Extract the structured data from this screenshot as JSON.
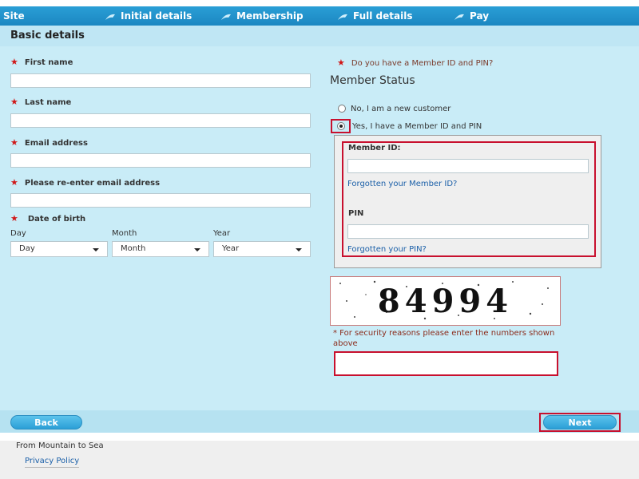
{
  "topnav": {
    "site": "Site",
    "steps": [
      "Initial details",
      "Membership",
      "Full details",
      "Pay"
    ]
  },
  "page": {
    "title": "Basic details"
  },
  "form": {
    "first_name_label": "First name",
    "last_name_label": "Last name",
    "email_label": "Email address",
    "reenter_email_label": "Please re-enter email address",
    "dob_label": "Date of birth",
    "day_label": "Day",
    "month_label": "Month",
    "year_label": "Year",
    "day_value": "Day",
    "month_value": "Month",
    "year_value": "Year"
  },
  "membership": {
    "question": "Do you have a Member ID and PIN?",
    "heading": "Member Status",
    "option_new": "No, I am a new customer",
    "option_existing": "Yes, I have a Member ID and PIN",
    "selected": "existing",
    "member_id_label": "Member ID:",
    "forgot_member_id": "Forgotten your Member ID?",
    "pin_label": "PIN",
    "forgot_pin": "Forgotten your PIN?"
  },
  "captcha": {
    "digits": "84994",
    "note": "* For security reasons please enter the numbers shown above"
  },
  "buttons": {
    "back": "Back",
    "next": "Next"
  },
  "footer": {
    "tagline": "From Mountain to Sea",
    "privacy": "Privacy Policy"
  },
  "colors": {
    "nav": "#1b87c1",
    "form_bg": "#c9ecf7",
    "required": "#d01818",
    "highlight": "#c8102e",
    "link": "#1a5fa8"
  },
  "icons": {
    "nav_step": "arrow-icon",
    "required": "asterisk-icon"
  }
}
